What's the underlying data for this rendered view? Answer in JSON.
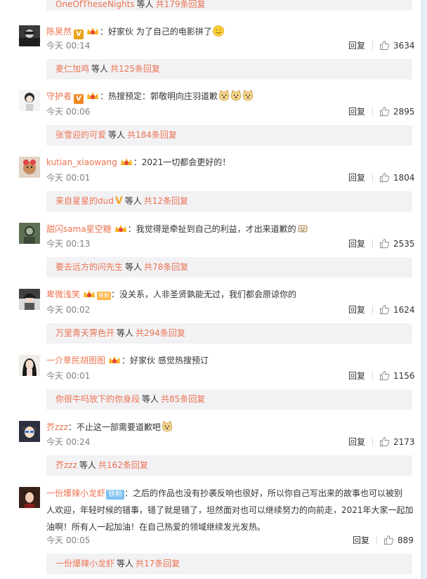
{
  "colors": {
    "link": "#eb7350",
    "text": "#333333",
    "meta": "#808080",
    "reply_bg": "#f2f2f5"
  },
  "labels": {
    "etc": "等人",
    "reply": "回复"
  },
  "top_reply": {
    "name": "OneOfTheseNights",
    "total": "共179条回复"
  },
  "comments": [
    {
      "user": "陈昊然",
      "text": "：好家伙 为了自己的电影拼了",
      "time": "今天 00:14",
      "likes": "3634",
      "reply_name": "麦仁加鸡",
      "reply_total": "共125条回复"
    },
    {
      "user": "守护者",
      "text": "：热搜预定：郭敬明向庄羽道歉",
      "time": "今天 00:06",
      "likes": "2895",
      "reply_name": "张雪迎的可爱",
      "reply_total": "共184条回复"
    },
    {
      "user": "kutian_xiaowang",
      "text": "：2021一切都会更好的！",
      "time": "今天 00:01",
      "likes": "1804",
      "reply_name": "来自星星的dud",
      "reply_total": "共12条回复"
    },
    {
      "user": "甜闪sama星空糖",
      "text": "：我觉得是牵扯到自己的利益，才出来道歉的",
      "time": "今天 00:13",
      "likes": "2535",
      "reply_name": "要去远方的问先生",
      "reply_total": "共78条回复"
    },
    {
      "user": "卑微浅笑",
      "badge": "铁粉",
      "text": "：没关系，人非圣贤孰能无过，我们都会原谅你的",
      "time": "今天 00:02",
      "likes": "1624",
      "reply_name": "万里青天霁色开",
      "reply_total": "共294条回复"
    },
    {
      "user": "一介草民胡图图",
      "text": "：好家伙 感觉热搜预订",
      "time": "今天 00:01",
      "likes": "1156",
      "reply_name": "你很牛吗放下的你身段",
      "reply_total": "共85条回复"
    },
    {
      "user": "芥zzz",
      "text": "：不止这一部需要道歉吧",
      "time": "今天 00:24",
      "likes": "2173",
      "reply_name": "芥zzz",
      "reply_total": "共162条回复"
    },
    {
      "user": "一份爆辣小龙虾",
      "badge": "铁粉",
      "text_lines": [
        "：之后的作品也没有抄袭反响也很好，所以你自己写出来的故事也可以被别",
        "人欢迎，年轻时候的错事，错了就是错了，坦然面对也可以继续努力的向前走，2021年大家一起加",
        "油啊！所有人一起加油！在自己热爱的领域继续发光发热。"
      ],
      "time": "今天 00:05",
      "likes": "889",
      "reply_name": "一份爆辣小龙虾",
      "reply_total": "共17条回复"
    }
  ]
}
